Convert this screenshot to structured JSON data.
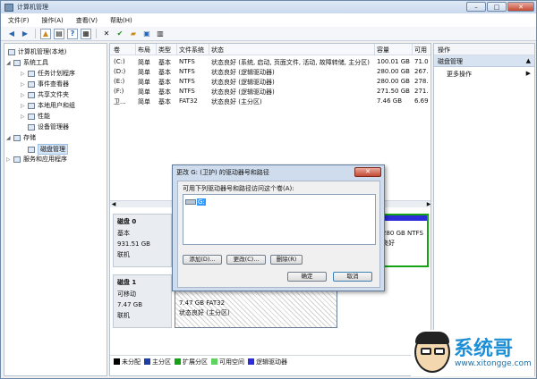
{
  "window": {
    "title": "计算机管理",
    "minimize": "–",
    "maximize": "□",
    "close": "✕"
  },
  "menu": {
    "items": [
      "文件(F)",
      "操作(A)",
      "查看(V)",
      "帮助(H)"
    ]
  },
  "toolbar": {
    "icons": [
      "back-arrow-icon",
      "forward-arrow-icon",
      "up-folder-icon",
      "properties-icon",
      "help-icon",
      "console-icon",
      "delete-icon",
      "check-icon",
      "open-icon",
      "save-icon",
      "show-icon"
    ]
  },
  "tree": {
    "root": "计算机管理(本地)",
    "system_tools": "系统工具",
    "task_scheduler": "任务计划程序",
    "event_viewer": "事件查看器",
    "shared_folders": "共享文件夹",
    "local_users": "本地用户和组",
    "performance": "性能",
    "device_manager": "设备管理器",
    "storage": "存储",
    "disk_management": "磁盘管理",
    "services": "服务和应用程序"
  },
  "volumes": {
    "headers": [
      "卷",
      "布局",
      "类型",
      "文件系统",
      "状态",
      "容量",
      "可用"
    ],
    "rows": [
      [
        "(C:)",
        "简单",
        "基本",
        "NTFS",
        "状态良好 (系统, 启动, 页面文件, 活动, 故障转储, 主分区)",
        "100.01 GB",
        "71.0"
      ],
      [
        "(D:)",
        "简单",
        "基本",
        "NTFS",
        "状态良好 (逻辑驱动器)",
        "280.00 GB",
        "267."
      ],
      [
        "(E:)",
        "简单",
        "基本",
        "NTFS",
        "状态良好 (逻辑驱动器)",
        "280.00 GB",
        "278."
      ],
      [
        "(F:)",
        "简单",
        "基本",
        "NTFS",
        "状态良好 (逻辑驱动器)",
        "271.50 GB",
        "271."
      ],
      [
        "卫...",
        "简单",
        "基本",
        "FAT32",
        "状态良好 (主分区)",
        "7.46 GB",
        "6.69"
      ]
    ]
  },
  "disks": [
    {
      "name": "磁盘 0",
      "type": "基本",
      "size": "931.51 GB",
      "status": "联机"
    },
    {
      "name": "磁盘 1",
      "type": "可移动",
      "size": "7.47 GB",
      "status": "联机"
    }
  ],
  "partitions": {
    "disk0_right_size": "280 GB NTFS",
    "disk0_right_status": "良好",
    "disk1_size": "7.47 GB FAT32",
    "disk1_status": "状态良好 (主分区)"
  },
  "legend": [
    {
      "label": "未分配",
      "color": "#000000"
    },
    {
      "label": "主分区",
      "color": "#1f3fa8"
    },
    {
      "label": "扩展分区",
      "color": "#14a314"
    },
    {
      "label": "可用空间",
      "color": "#5fd35f"
    },
    {
      "label": "逻辑驱动器",
      "color": "#2c2cd8"
    }
  ],
  "actions": {
    "header": "操作",
    "section": "磁盘管理",
    "more": "更多操作"
  },
  "dialog": {
    "title": "更改 G: (卫护) 的驱动器号和路径",
    "label": "可用下列驱动器号和路径访问这个卷(A):",
    "entry": "G:",
    "add": "添加(D)...",
    "change": "更改(C)...",
    "remove": "删除(R)",
    "ok": "确定",
    "cancel": "取消"
  },
  "watermark": {
    "brand": "系统哥",
    "url": "www.xitongge.com"
  }
}
